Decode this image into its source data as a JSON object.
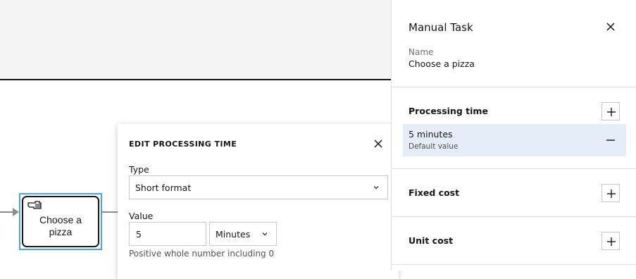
{
  "diagram": {
    "task_label": "Choose a pizza",
    "task_icon": "hand-icon"
  },
  "popover": {
    "title": "EDIT PROCESSING TIME",
    "type_label": "Type",
    "type_value": "Short format",
    "value_label": "Value",
    "value_input": "5",
    "unit_value": "Minutes",
    "helper_text": "Positive whole number including 0"
  },
  "panel": {
    "title": "Manual Task",
    "name_label": "Name",
    "name_value": "Choose a pizza",
    "sections": {
      "processing_time": "Processing time",
      "fixed_cost": "Fixed cost",
      "unit_cost": "Unit cost"
    },
    "processing_value": "5 minutes",
    "processing_sub": "Default value"
  },
  "colors": {
    "selection": "#4ba3e3",
    "value_row_bg": "#e5eef8"
  }
}
